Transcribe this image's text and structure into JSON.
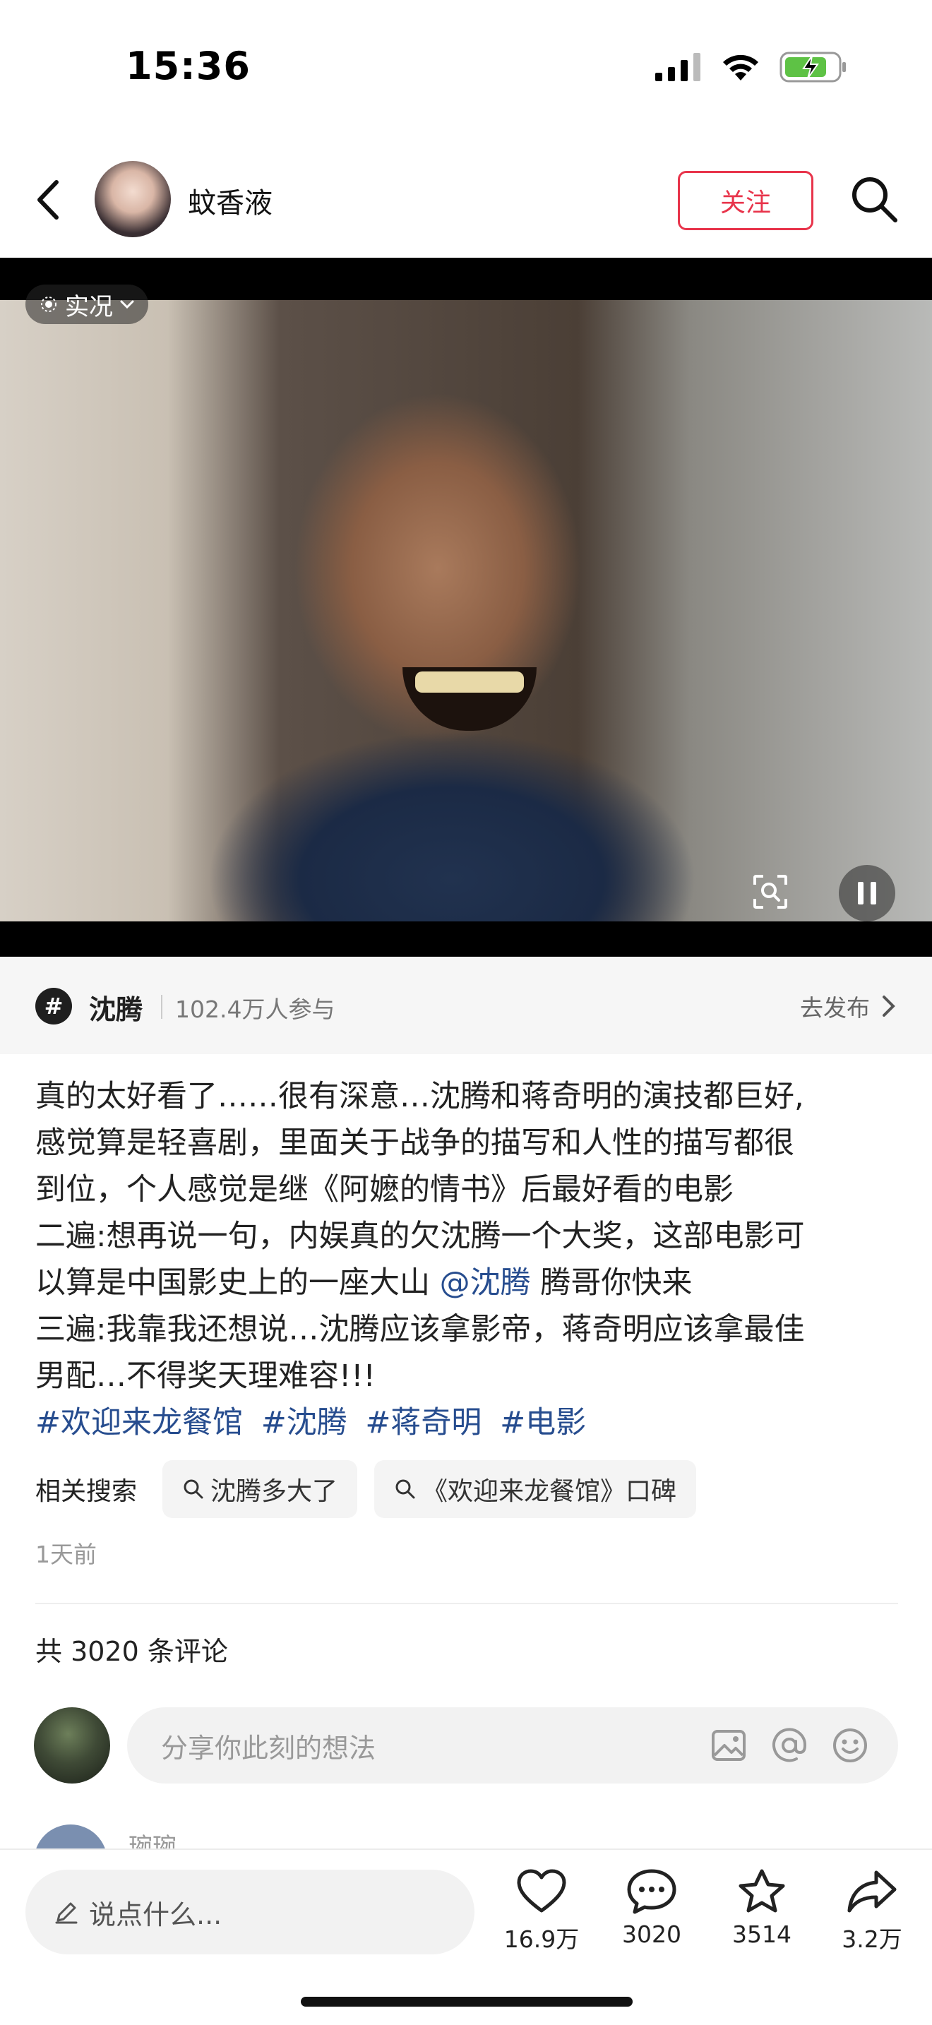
{
  "status_bar": {
    "time": "15:36"
  },
  "header": {
    "author_name": "蚊香液",
    "follow_label": "关注"
  },
  "video": {
    "live_label": "实况"
  },
  "topic": {
    "name": "沈腾",
    "participants": "102.4万人参与",
    "publish_label": "去发布"
  },
  "post": {
    "line1": "真的太好看了……很有深意…沈腾和蒋奇明的演技都巨好,",
    "line2": "感觉算是轻喜剧，里面关于战争的描写和人性的描写都很",
    "line3": "到位，个人感觉是继《阿嬷的情书》后最好看的电影",
    "line4": "二遍:想再说一句，内娱真的欠沈腾一个大奖，这部电影可",
    "line5a": "以算是中国影史上的一座大山",
    "mention": "@沈腾",
    "line5b": "腾哥你快来",
    "line6": "三遍:我靠我还想说…沈腾应该拿影帝，蒋奇明应该拿最佳",
    "line7": "男配…不得奖天理难容!!!",
    "hashtags": [
      "#欢迎来龙餐馆",
      "#沈腾",
      "#蒋奇明",
      "#电影"
    ]
  },
  "related_search": {
    "label": "相关搜索",
    "items": [
      "沈腾多大了",
      "《欢迎来龙餐馆》口碑"
    ]
  },
  "time_ago": "1天前",
  "comments": {
    "count_label": "共 3020 条评论",
    "input_placeholder": "分享你此刻的想法",
    "next_comment_name": "琬琬"
  },
  "bottom_bar": {
    "say_placeholder": "说点什么...",
    "likes": "16.9万",
    "comments": "3020",
    "favorites": "3514",
    "shares": "3.2万"
  },
  "colors": {
    "accent": "#e8344b",
    "link": "#274d8f"
  },
  "icons": [
    "back-icon",
    "search-icon",
    "live-icon",
    "chevron-down-icon",
    "scan-icon",
    "pause-icon",
    "topic-hash-icon",
    "chevron-right-icon",
    "image-icon",
    "at-icon",
    "emoji-icon",
    "pencil-icon",
    "heart-icon",
    "comment-icon",
    "star-icon",
    "share-icon"
  ]
}
